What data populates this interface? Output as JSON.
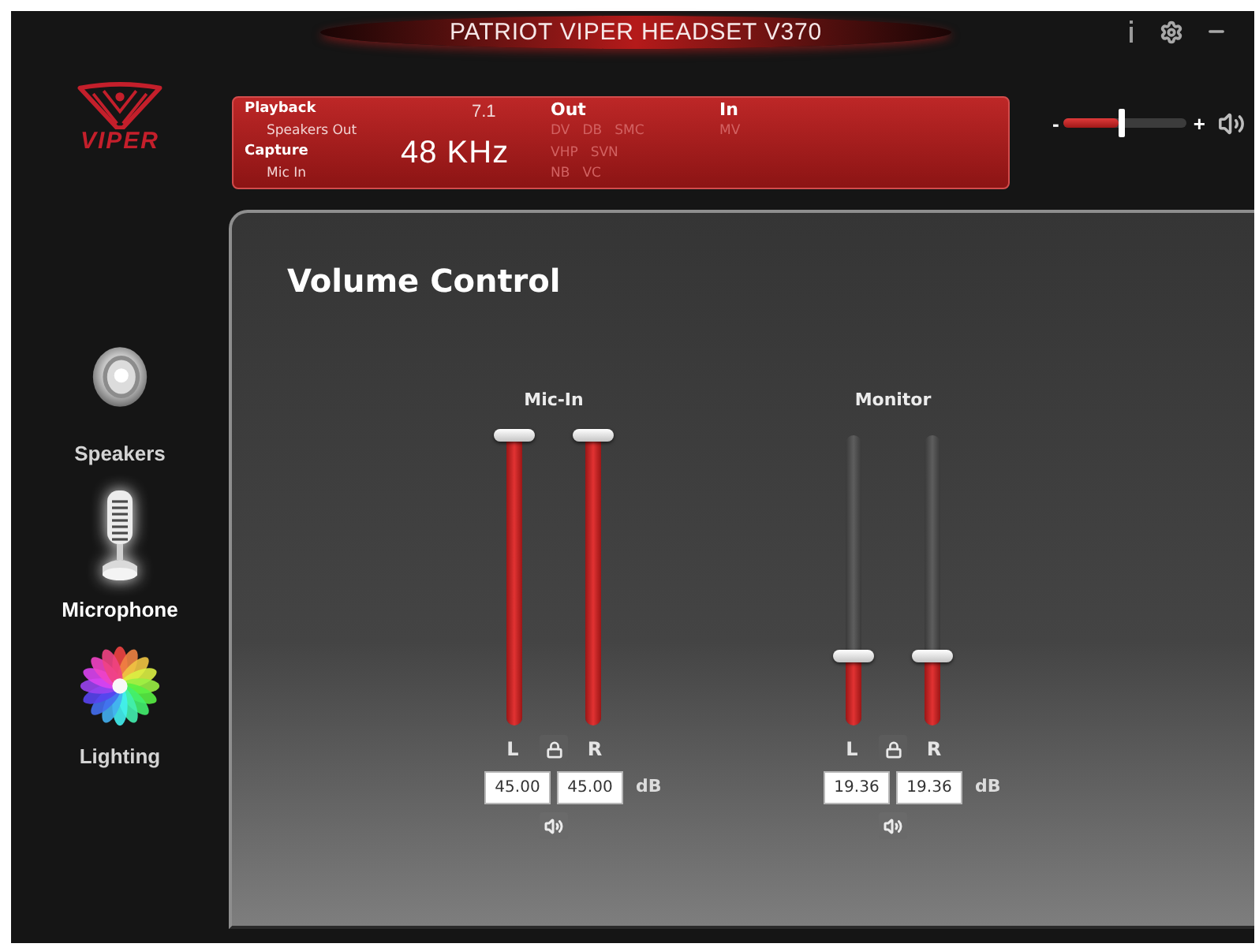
{
  "window": {
    "title": "PATRIOT VIPER HEADSET V370"
  },
  "logo": {
    "wordmark": "VIPER"
  },
  "status_panel": {
    "rows": [
      {
        "label": "Playback",
        "device": "Speakers Out"
      },
      {
        "label": "Capture",
        "device": "Mic In"
      }
    ],
    "channels": "7.1",
    "sample_rate": "48 KHz",
    "groups": [
      {
        "label": "Out",
        "feature_rows": [
          [
            {
              "label": "DV",
              "active": false
            },
            {
              "label": "DB",
              "active": false
            },
            {
              "label": "SMC",
              "active": false
            }
          ],
          [
            {
              "label": "VHP",
              "active": false
            },
            {
              "label": "SVN",
              "active": false
            }
          ],
          [
            {
              "label": "NB",
              "active": false
            },
            {
              "label": "VC",
              "active": false
            }
          ]
        ]
      },
      {
        "label": "In",
        "feature_rows": [
          [
            {
              "label": "MV",
              "active": false
            }
          ]
        ]
      }
    ]
  },
  "master_volume": {
    "minus": "-",
    "plus": "+",
    "level": 0.47
  },
  "sidebar": {
    "items": [
      {
        "kind": "speakers",
        "label": "Speakers",
        "selected": false
      },
      {
        "kind": "microphone",
        "label": "Microphone",
        "selected": true
      },
      {
        "kind": "lighting",
        "label": "Lighting",
        "selected": false
      }
    ]
  },
  "panel": {
    "title": "Volume Control",
    "groups": [
      {
        "label": "Mic-In",
        "unit": "dB",
        "channels": [
          {
            "label": "L",
            "level": 1,
            "value": "45.00"
          },
          {
            "label": "R",
            "level": 1,
            "value": "45.00"
          }
        ]
      },
      {
        "label": "Monitor",
        "unit": "dB",
        "channels": [
          {
            "label": "L",
            "level": 0.24,
            "value": "19.36"
          },
          {
            "label": "R",
            "level": 0.24,
            "value": "19.36"
          }
        ]
      }
    ]
  }
}
